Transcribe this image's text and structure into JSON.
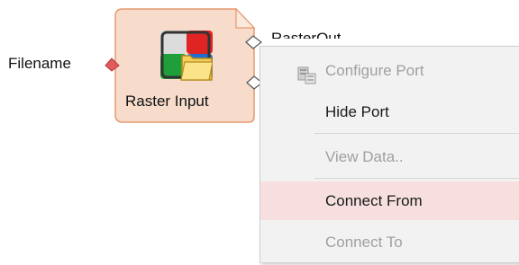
{
  "node": {
    "title": "Raster Input",
    "input_port": "Filename",
    "output_port": "RasterOut",
    "colors": {
      "fill": "#f7dccb",
      "border": "#e59a70",
      "input_port": "#e05b5b",
      "output_port": "#ffffff"
    },
    "icon": "raster-folder-icon"
  },
  "context_menu": {
    "items": [
      {
        "label": "Configure Port",
        "enabled": false,
        "icon": "configure-port-icon"
      },
      {
        "label": "Hide Port",
        "enabled": true
      },
      {
        "label": "View Data..",
        "enabled": false
      },
      {
        "label": "Connect From",
        "enabled": true,
        "highlighted": true
      },
      {
        "label": "Connect To",
        "enabled": false
      }
    ],
    "colors": {
      "background": "#f2f2f2",
      "highlight": "#f7dfdf",
      "disabled_text": "#a0a0a0"
    }
  }
}
